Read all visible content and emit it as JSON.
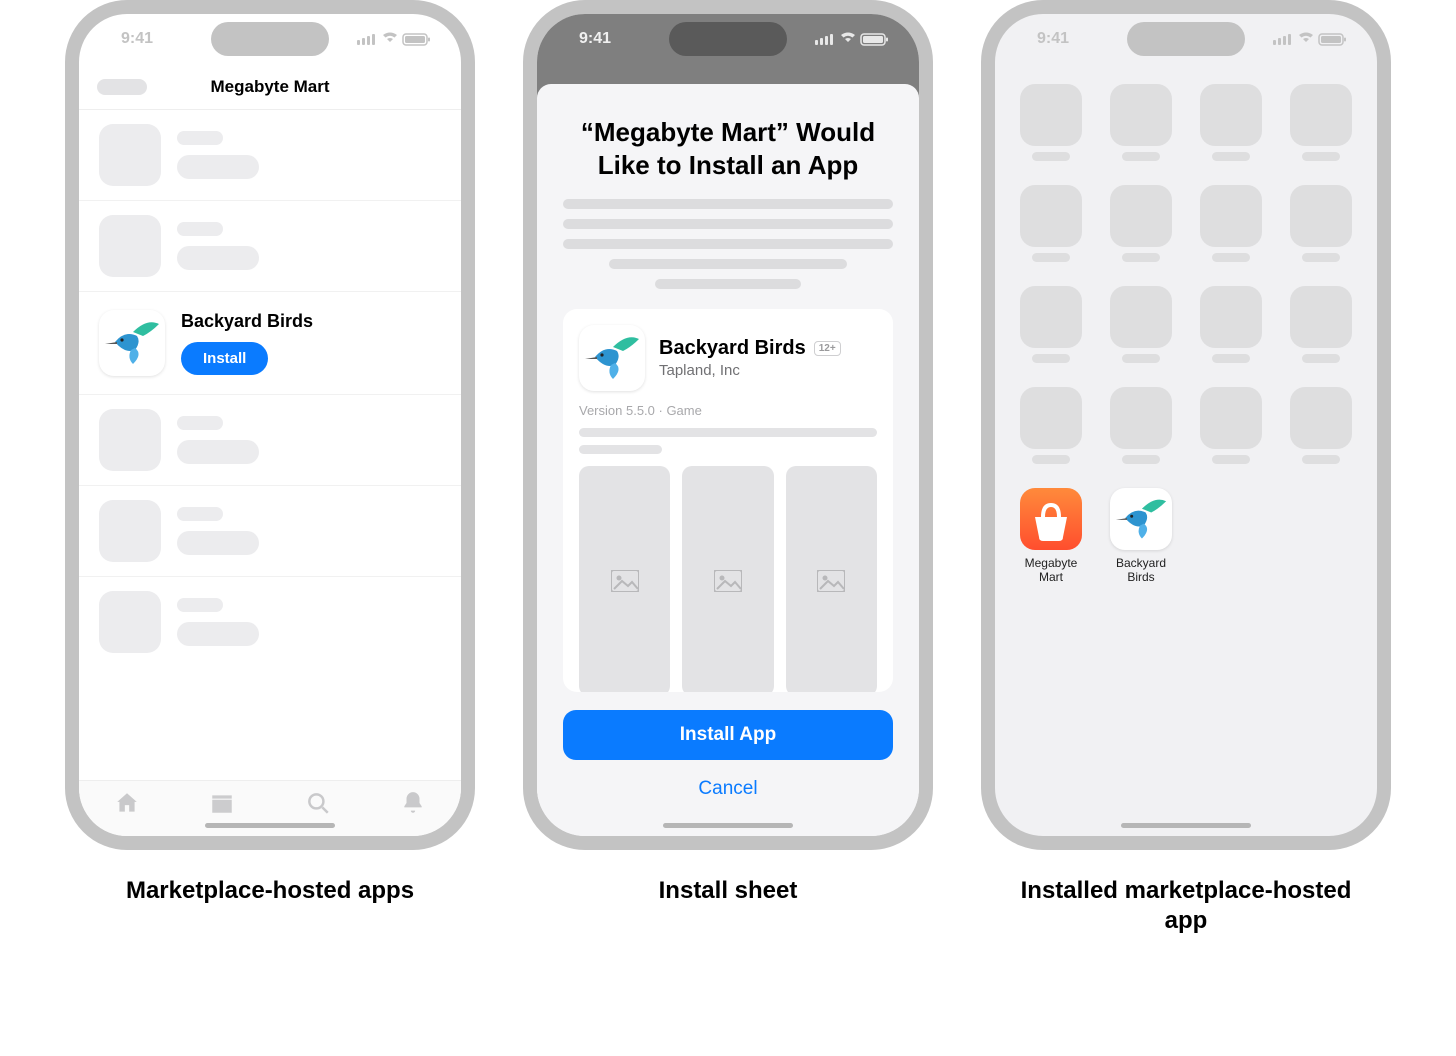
{
  "status_time": "9:41",
  "screen1": {
    "nav_title": "Megabyte Mart",
    "featured_app_name": "Backyard Birds",
    "install_label": "Install",
    "caption": "Marketplace-hosted apps"
  },
  "screen2": {
    "sheet_title": "“Megabyte Mart” Would Like to Install an App",
    "app_name": "Backyard Birds",
    "age_rating": "12+",
    "developer": "Tapland, Inc",
    "version_category": "Version 5.5.0 · Game",
    "install_app_label": "Install App",
    "cancel_label": "Cancel",
    "caption": "Install sheet"
  },
  "screen3": {
    "app1_label": "Megabyte Mart",
    "app2_label": "Backyard Birds",
    "caption": "Installed marketplace-hosted app"
  }
}
